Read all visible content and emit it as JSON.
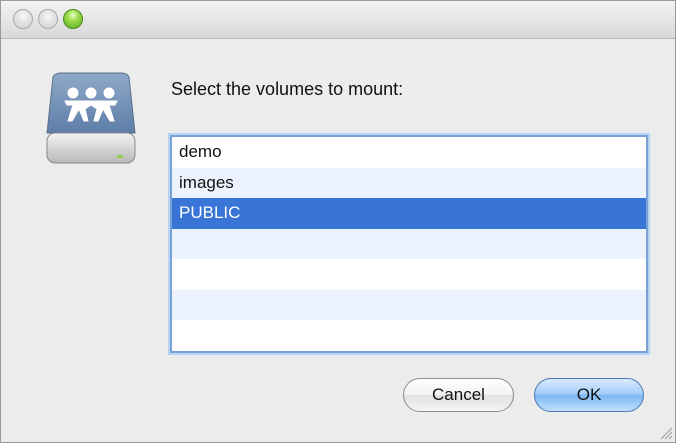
{
  "window": {
    "title_buttons": [
      "close-icon",
      "minimize-icon",
      "zoom-icon"
    ]
  },
  "dialog": {
    "icon": "network-volume-icon",
    "prompt": "Select the volumes to mount:",
    "volumes": [
      {
        "name": "demo",
        "selected": false
      },
      {
        "name": "images",
        "selected": false
      },
      {
        "name": "PUBLIC",
        "selected": true
      }
    ],
    "cancel_label": "Cancel",
    "ok_label": "OK"
  },
  "colors": {
    "selection": "#3875d7",
    "alt_row": "#edf3fe",
    "default_button": "#7db7f2"
  }
}
